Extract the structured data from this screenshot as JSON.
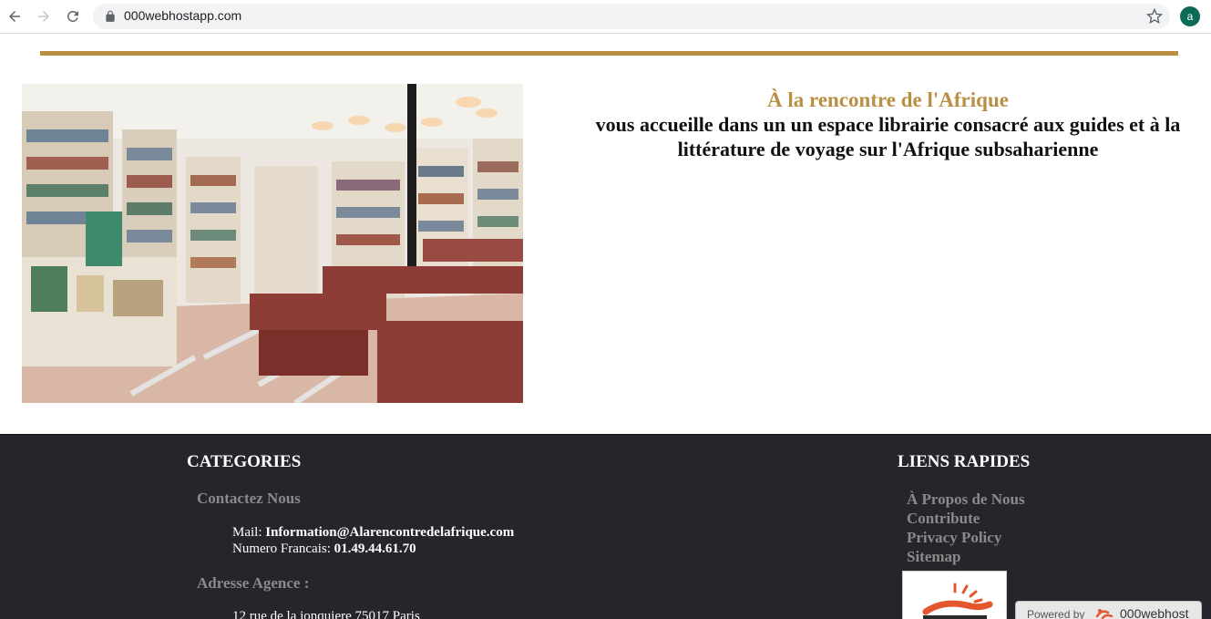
{
  "browser": {
    "url": "000webhostapp.com",
    "avatar_letter": "a",
    "icons": [
      "back-arrow-icon",
      "forward-arrow-icon",
      "reload-icon",
      "lock-icon",
      "star-icon"
    ]
  },
  "colors": {
    "accent_gold": "#b88f43",
    "footer_bg": "#25262b",
    "muted_text": "#8a8a8a"
  },
  "hero": {
    "image_subject": "bookshop interior with shelves and red benches",
    "title": "À la rencontre de l'Afrique",
    "text": "vous accueille dans un un espace librairie consacré aux guides et à la littérature de voyage sur l'Afrique subsaharienne"
  },
  "footer": {
    "categories": {
      "heading": "CATEGORIES",
      "contact_heading": "Contactez Nous",
      "mail_label": "Mail: ",
      "mail_value": "Information@Alarencontredelafrique.com",
      "phone_label": "Numero Francais: ",
      "phone_value": "01.49.44.61.70",
      "address_heading": "Adresse Agence :",
      "address_value": "12 rue de la jonquiere 75017 Paris"
    },
    "quick_links": {
      "heading": "LIENS RAPIDES",
      "links": [
        "À Propos de Nous",
        "Contribute",
        "Privacy Policy",
        "Sitemap"
      ]
    },
    "badge": {
      "powered_label": "Powered by",
      "brand": "000webhost"
    }
  }
}
